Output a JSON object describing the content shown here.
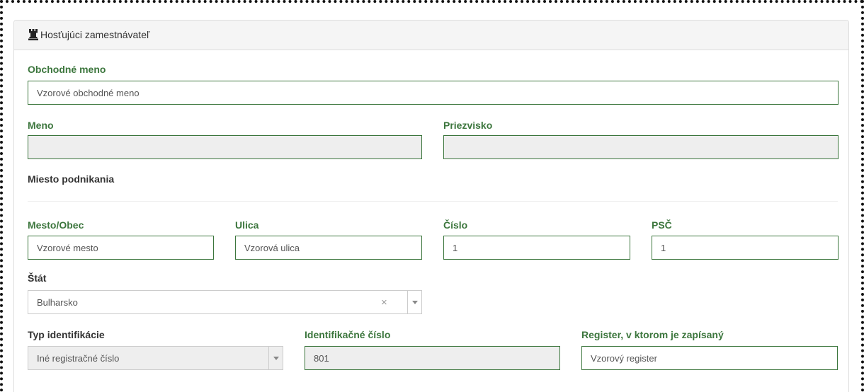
{
  "panel": {
    "title": "Hosťujúci zamestnávateľ",
    "icon": "chess-rook-icon"
  },
  "form": {
    "business_name": {
      "label": "Obchodné meno",
      "value": "Vzorové obchodné meno"
    },
    "first_name": {
      "label": "Meno",
      "value": ""
    },
    "last_name": {
      "label": "Priezvisko",
      "value": ""
    },
    "place_of_business": {
      "heading": "Miesto podnikania"
    },
    "city": {
      "label": "Mesto/Obec",
      "value": "Vzorové mesto"
    },
    "street": {
      "label": "Ulica",
      "value": "Vzorová ulica"
    },
    "number": {
      "label": "Číslo",
      "value": "1"
    },
    "postal_code": {
      "label": "PSČ",
      "value": "1"
    },
    "country": {
      "label": "Štát",
      "value": "Bulharsko",
      "clear_symbol": "×"
    },
    "id_type": {
      "label": "Typ identifikácie",
      "value": "Iné registračné číslo"
    },
    "id_number": {
      "label": "Identifikačné číslo",
      "value": "801"
    },
    "register": {
      "label": "Register, v ktorom je zapísaný",
      "value": "Vzorový register"
    }
  },
  "colors": {
    "label_green": "#3c763d",
    "border_green": "#3c763d",
    "disabled_bg": "#eeeeee",
    "heading_bg": "#f5f5f5"
  }
}
